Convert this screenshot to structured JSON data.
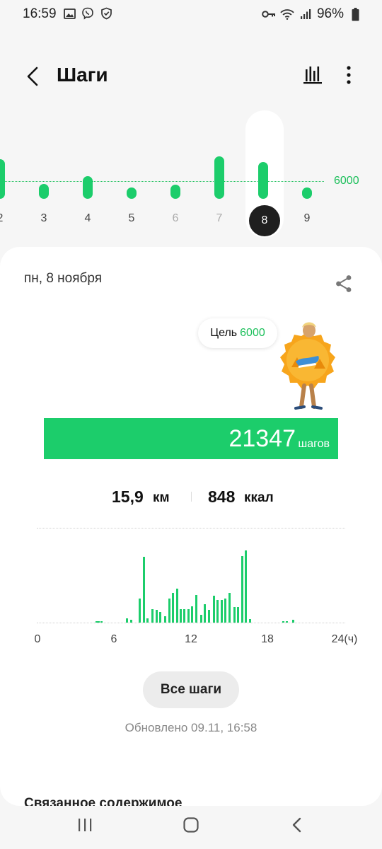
{
  "status_bar": {
    "time": "16:59",
    "battery": "96%",
    "left_icons": [
      "image-icon",
      "viber-icon",
      "shield-icon"
    ],
    "right_icons": [
      "key-icon",
      "wifi-icon",
      "signal-icon",
      "battery-icon"
    ]
  },
  "header": {
    "title": "Шаги",
    "icons": [
      "back-arrow-icon",
      "bar-chart-icon",
      "more-vert-icon"
    ]
  },
  "day_selector": {
    "goal_label": "6000",
    "selected": "8",
    "days": [
      {
        "label": "2",
        "level": 1.0,
        "muted": false
      },
      {
        "label": "3",
        "level": 0.38,
        "muted": false
      },
      {
        "label": "4",
        "level": 0.57,
        "muted": false
      },
      {
        "label": "5",
        "level": 0.29,
        "muted": false
      },
      {
        "label": "6",
        "level": 0.36,
        "muted": true
      },
      {
        "label": "7",
        "level": 1.07,
        "muted": true
      },
      {
        "label": "8",
        "level": 0.93,
        "muted": false
      },
      {
        "label": "9",
        "level": 0.29,
        "muted": false
      }
    ]
  },
  "card": {
    "date": "пн, 8 ноября",
    "goal_text": "Цель",
    "goal_value": "6000",
    "steps": "21347",
    "steps_unit": "шагов",
    "distance": "15,9",
    "distance_unit": "км",
    "calories": "848",
    "calories_unit": "ккал",
    "all_steps_button": "Все шаги",
    "updated": "Обновлено 09.11, 16:58",
    "related_heading": "Связанное содержимое"
  },
  "hourly_chart": {
    "x_ticks": [
      "0",
      "6",
      "12",
      "18",
      "24(ч)"
    ],
    "bars": [
      [
        4.6,
        0.02
      ],
      [
        4.8,
        0.02
      ],
      [
        5.0,
        0.02
      ],
      [
        7.0,
        0.06
      ],
      [
        7.3,
        0.04
      ],
      [
        8.0,
        0.33
      ],
      [
        8.3,
        0.91
      ],
      [
        8.6,
        0.06
      ],
      [
        9.0,
        0.19
      ],
      [
        9.3,
        0.18
      ],
      [
        9.6,
        0.15
      ],
      [
        10.0,
        0.09
      ],
      [
        10.3,
        0.33
      ],
      [
        10.6,
        0.41
      ],
      [
        10.9,
        0.47
      ],
      [
        11.2,
        0.19
      ],
      [
        11.5,
        0.19
      ],
      [
        11.8,
        0.19
      ],
      [
        12.1,
        0.23
      ],
      [
        12.4,
        0.38
      ],
      [
        12.8,
        0.11
      ],
      [
        13.1,
        0.25
      ],
      [
        13.4,
        0.18
      ],
      [
        13.8,
        0.37
      ],
      [
        14.1,
        0.31
      ],
      [
        14.4,
        0.31
      ],
      [
        14.7,
        0.33
      ],
      [
        15.0,
        0.41
      ],
      [
        15.4,
        0.22
      ],
      [
        15.7,
        0.22
      ],
      [
        16.0,
        0.92
      ],
      [
        16.3,
        1.0
      ],
      [
        16.6,
        0.05
      ],
      [
        19.2,
        0.02
      ],
      [
        19.5,
        0.02
      ],
      [
        20.0,
        0.04
      ]
    ]
  },
  "nav_bar": {
    "icons": [
      "recents-icon",
      "home-icon",
      "back-icon"
    ]
  }
}
